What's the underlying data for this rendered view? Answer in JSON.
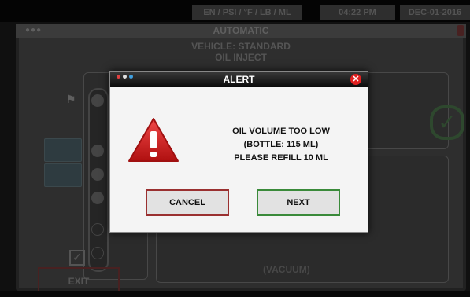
{
  "statusbar": {
    "units": "EN / PSI / °F / LB / ML",
    "time": "04:22 PM",
    "date": "DEC-01-2016"
  },
  "app": {
    "title": "AUTOMATIC",
    "vehicle_line1": "VEHICLE: STANDARD",
    "vehicle_line2": "OIL INJECT",
    "exit_label": "EXIT",
    "vacuum_label": "(VACUUM)"
  },
  "alert": {
    "title": "ALERT",
    "message_line1": "OIL VOLUME TOO LOW",
    "message_line2": "(BOTTLE: 115 ML)",
    "message_line3": "PLEASE REFILL 10 ML",
    "cancel_label": "CANCEL",
    "next_label": "NEXT",
    "close_icon": "close-icon",
    "warning_icon": "warning-icon"
  },
  "colors": {
    "cancel_border": "#9a3030",
    "next_border": "#3a8a3a",
    "close_red": "#e02020",
    "warning_red": "#d82020"
  }
}
